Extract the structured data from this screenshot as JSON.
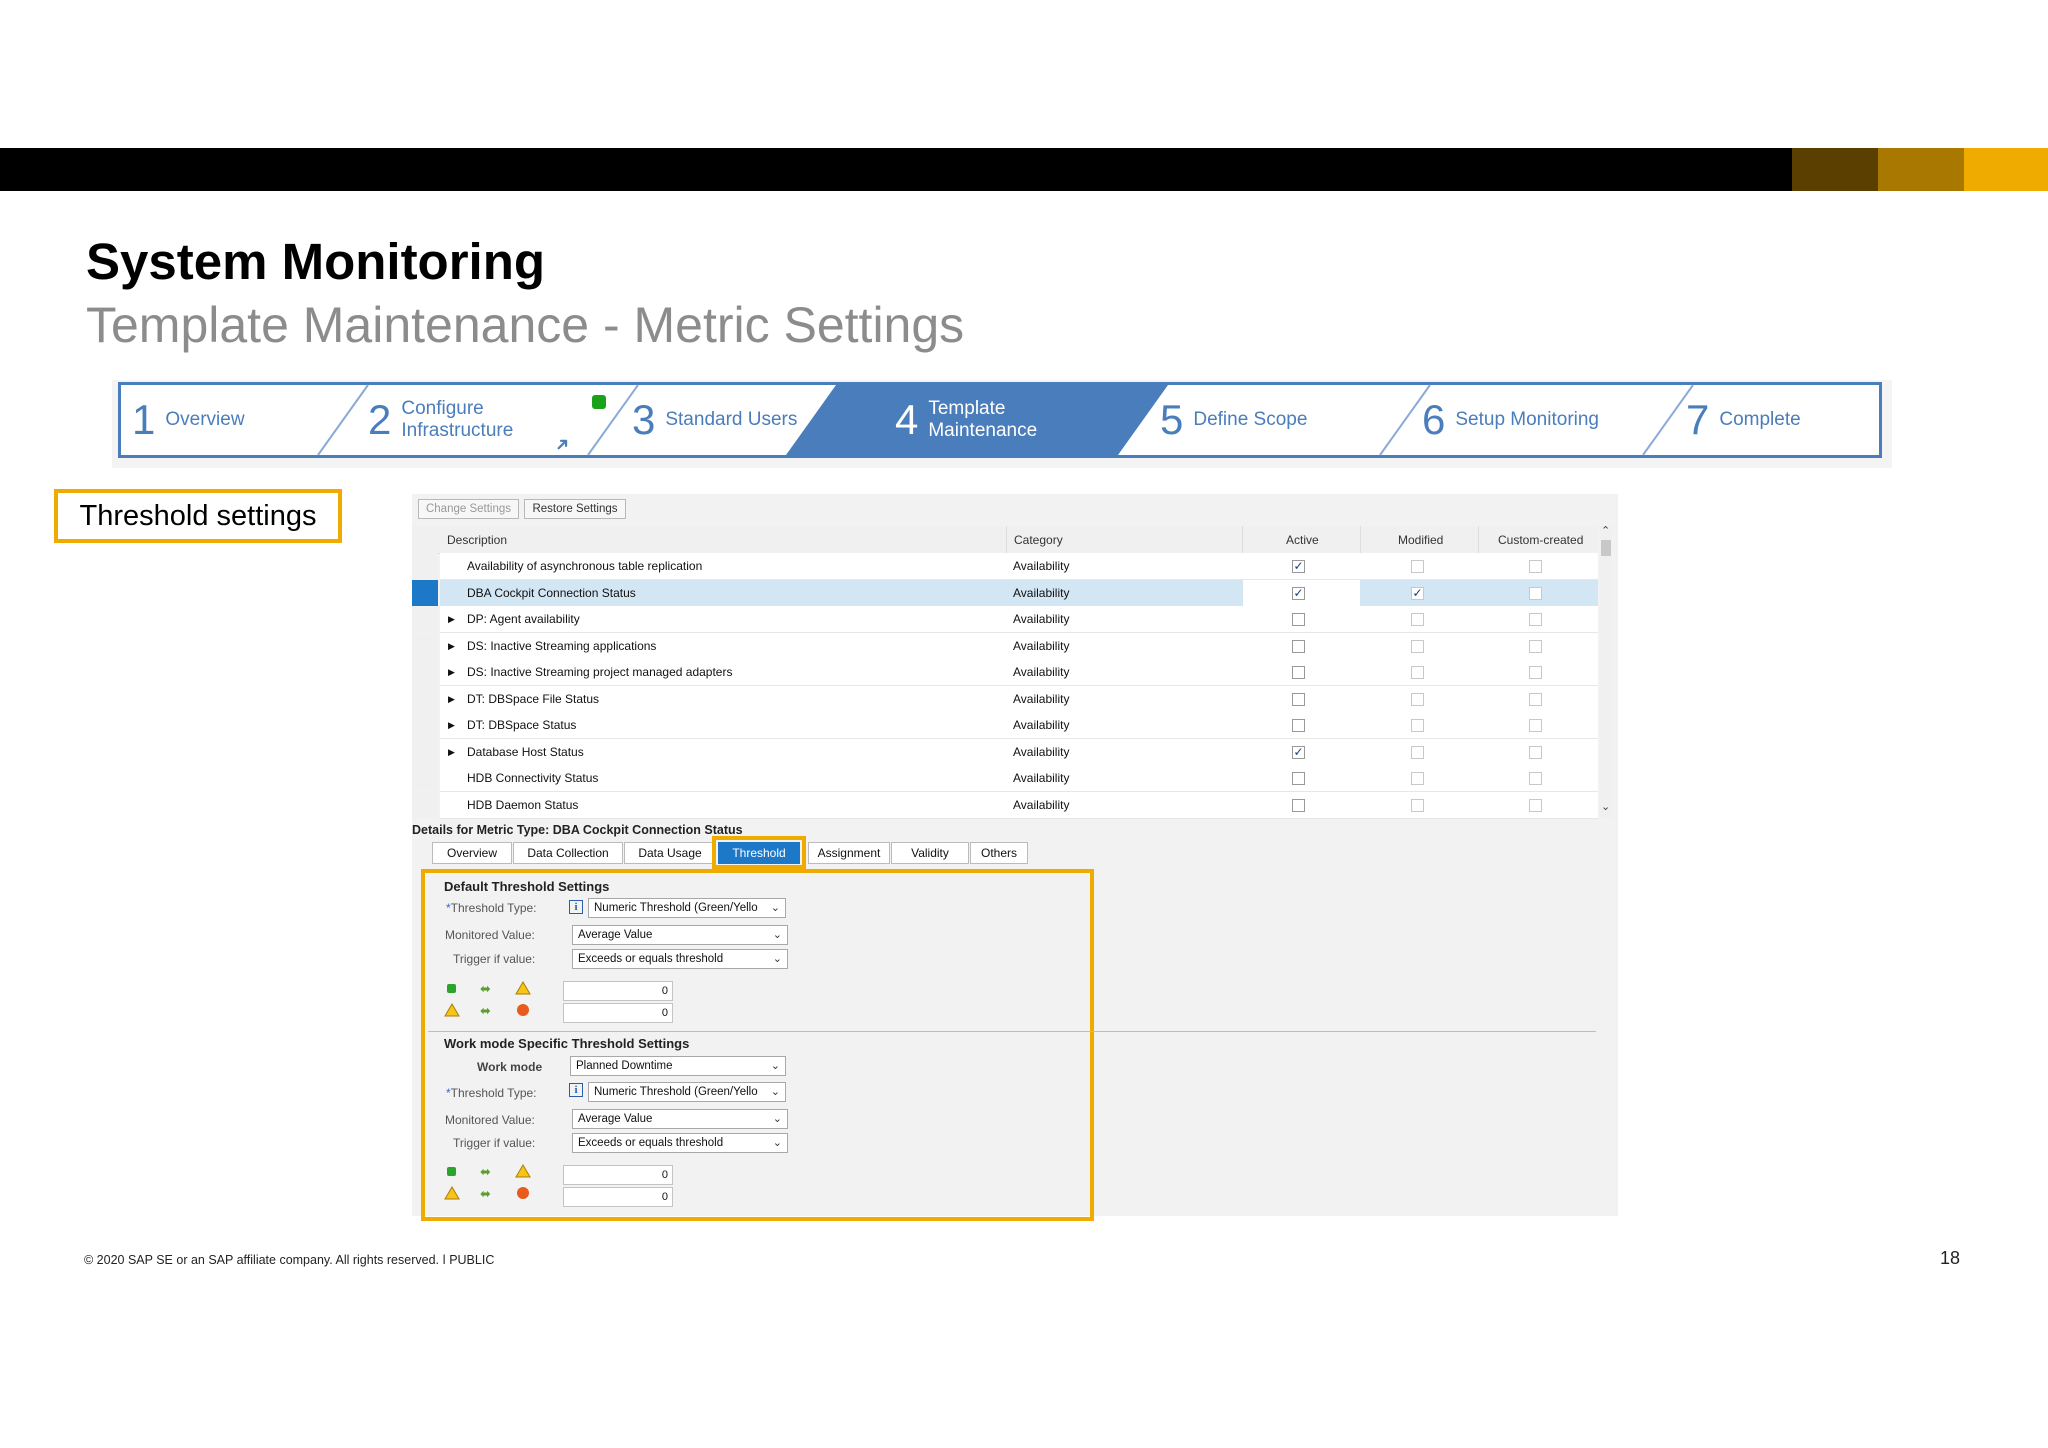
{
  "header": {
    "title": "System Monitoring",
    "subtitle": "Template Maintenance - Metric Settings",
    "brand_colors": [
      "#5a3f00",
      "#a87800",
      "#f0ab00"
    ]
  },
  "roadmap": {
    "steps": [
      {
        "num": "1",
        "label": "Overview",
        "active": false
      },
      {
        "num": "2",
        "label": "Configure\nInfrastructure",
        "active": false
      },
      {
        "num": "3",
        "label": "Standard Users",
        "active": false
      },
      {
        "num": "4",
        "label": "Template\nMaintenance",
        "active": true
      },
      {
        "num": "5",
        "label": "Define Scope",
        "active": false
      },
      {
        "num": "6",
        "label": "Setup Monitoring",
        "active": false
      },
      {
        "num": "7",
        "label": "Complete",
        "active": false
      }
    ],
    "accent": "#4a7dbb"
  },
  "callout": "Threshold settings",
  "toolbar": {
    "change": "Change Settings",
    "restore": "Restore Settings"
  },
  "table": {
    "columns": [
      "Description",
      "Category",
      "Active",
      "Modified",
      "Custom-created"
    ],
    "rows": [
      {
        "expand": false,
        "desc": "Availability of asynchronous table replication",
        "cat": "Availability",
        "active": true,
        "modified": false,
        "custom": false,
        "selected": false
      },
      {
        "expand": false,
        "desc": "DBA Cockpit Connection Status",
        "cat": "Availability",
        "active": true,
        "modified": true,
        "custom": false,
        "selected": true
      },
      {
        "expand": true,
        "desc": "DP: Agent availability",
        "cat": "Availability",
        "active": false,
        "modified": false,
        "custom": false,
        "selected": false
      },
      {
        "expand": true,
        "desc": "DS: Inactive Streaming applications",
        "cat": "Availability",
        "active": false,
        "modified": false,
        "custom": false,
        "selected": false
      },
      {
        "expand": true,
        "desc": "DS: Inactive Streaming project managed adapters",
        "cat": "Availability",
        "active": false,
        "modified": false,
        "custom": false,
        "selected": false
      },
      {
        "expand": true,
        "desc": "DT: DBSpace File Status",
        "cat": "Availability",
        "active": false,
        "modified": false,
        "custom": false,
        "selected": false
      },
      {
        "expand": true,
        "desc": "DT: DBSpace Status",
        "cat": "Availability",
        "active": false,
        "modified": false,
        "custom": false,
        "selected": false
      },
      {
        "expand": true,
        "desc": "Database Host Status",
        "cat": "Availability",
        "active": true,
        "modified": false,
        "custom": false,
        "selected": false
      },
      {
        "expand": false,
        "desc": "HDB Connectivity Status",
        "cat": "Availability",
        "active": false,
        "modified": false,
        "custom": false,
        "selected": false
      },
      {
        "expand": false,
        "desc": "HDB Daemon Status",
        "cat": "Availability",
        "active": false,
        "modified": false,
        "custom": false,
        "selected": false
      }
    ]
  },
  "details": {
    "title": "Details for Metric Type: DBA Cockpit Connection Status",
    "tabs": [
      "Overview",
      "Data Collection",
      "Data Usage",
      "Threshold",
      "Assignment",
      "Validity",
      "Others"
    ],
    "selected_tab": "Threshold"
  },
  "default_threshold": {
    "heading": "Default Threshold Settings",
    "threshold_type_label": "Threshold Type:",
    "threshold_type_value": "Numeric Threshold (Green/Yello",
    "monitored_label": "Monitored Value:",
    "monitored_value": "Average Value",
    "trigger_label": "Trigger if value:",
    "trigger_value": "Exceeds or equals threshold",
    "value1": "0",
    "value2": "0"
  },
  "workmode_threshold": {
    "heading": "Work mode Specific Threshold Settings",
    "workmode_label": "Work mode",
    "workmode_value": "Planned Downtime",
    "threshold_type_label": "Threshold Type:",
    "threshold_type_value": "Numeric Threshold (Green/Yello",
    "monitored_label": "Monitored Value:",
    "monitored_value": "Average Value",
    "trigger_label": "Trigger if value:",
    "trigger_value": "Exceeds or equals threshold",
    "value1": "0",
    "value2": "0"
  },
  "footer": {
    "copyright": "© 2020 SAP SE or an SAP affiliate company. All rights reserved.  ǀ   PUBLIC",
    "page": "18"
  }
}
